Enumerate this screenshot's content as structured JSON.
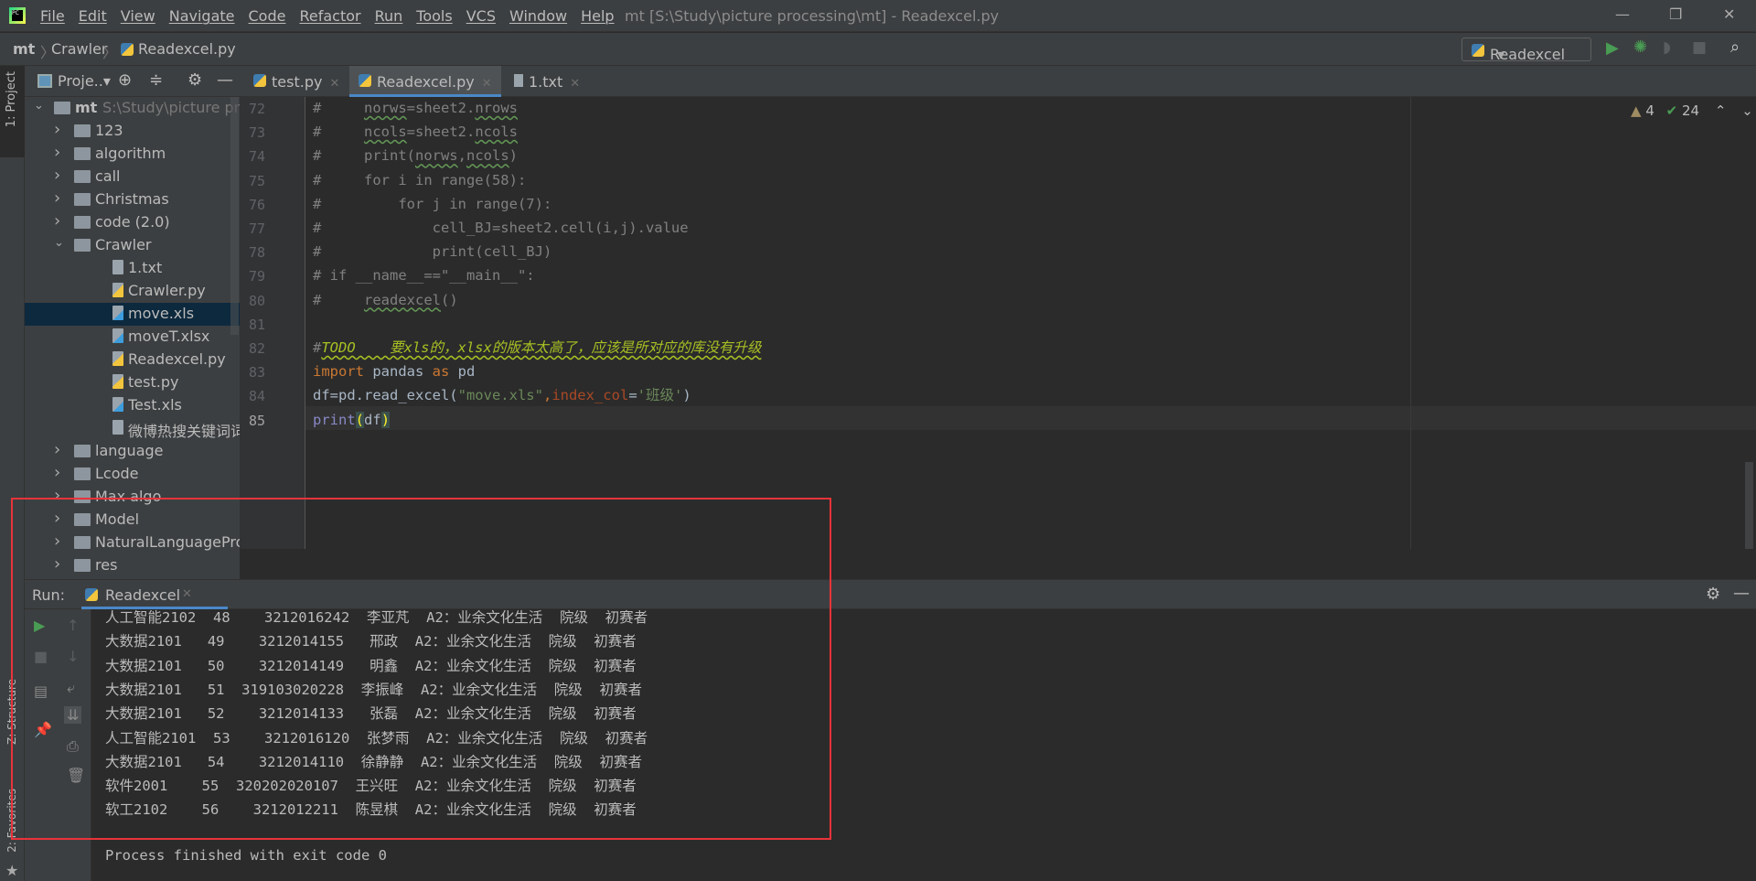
{
  "window": {
    "title": "mt [S:\\Study\\picture processing\\mt] - Readexcel.py",
    "logo": "PC"
  },
  "menu": [
    "File",
    "Edit",
    "View",
    "Navigate",
    "Code",
    "Refactor",
    "Run",
    "Tools",
    "VCS",
    "Window",
    "Help"
  ],
  "breadcrumb": [
    "mt",
    "Crawler",
    "Readexcel.py"
  ],
  "run_config": "Readexcel",
  "project_toolbar": {
    "label": "Proje..▾"
  },
  "left_strip": {
    "project": "1: Project",
    "structure": "Z: Structure",
    "favorites": "2: Favorites"
  },
  "tabs": [
    {
      "label": "test.py",
      "icon": "python-file-icon"
    },
    {
      "label": "Readexcel.py",
      "icon": "python-file-icon",
      "active": true
    },
    {
      "label": "1.txt",
      "icon": "text-file-icon"
    }
  ],
  "tree": [
    {
      "label": "mt",
      "extra": "S:\\Study\\picture proc",
      "type": "folder",
      "open": true,
      "depth": 0
    },
    {
      "label": "123",
      "type": "folder",
      "depth": 1
    },
    {
      "label": "algorithm",
      "type": "folder",
      "depth": 1
    },
    {
      "label": "call",
      "type": "folder",
      "depth": 1
    },
    {
      "label": "Christmas",
      "type": "folder",
      "depth": 1
    },
    {
      "label": "code   (2.0)",
      "type": "folder",
      "depth": 1
    },
    {
      "label": "Crawler",
      "type": "folder",
      "open": true,
      "depth": 1
    },
    {
      "label": "1.txt",
      "type": "file",
      "depth": 2
    },
    {
      "label": "Crawler.py",
      "type": "py",
      "depth": 2
    },
    {
      "label": "move.xls",
      "type": "unknown",
      "depth": 2,
      "selected": true
    },
    {
      "label": "moveT.xlsx",
      "type": "unknown",
      "depth": 2
    },
    {
      "label": "Readexcel.py",
      "type": "py",
      "depth": 2
    },
    {
      "label": "test.py",
      "type": "py",
      "depth": 2
    },
    {
      "label": "Test.xls",
      "type": "unknown",
      "depth": 2
    },
    {
      "label": "微博热搜关键词词频",
      "type": "file",
      "depth": 2
    },
    {
      "label": "language",
      "type": "folder",
      "depth": 1
    },
    {
      "label": "Lcode",
      "type": "folder",
      "depth": 1
    },
    {
      "label": "Max algo",
      "type": "folder",
      "depth": 1
    },
    {
      "label": "Model",
      "type": "folder",
      "depth": 1
    },
    {
      "label": "NaturalLanguageProc",
      "type": "folder",
      "depth": 1
    },
    {
      "label": "res",
      "type": "folder",
      "depth": 1
    }
  ],
  "inspections": {
    "warnings": "4",
    "typos": "24"
  },
  "code": [
    {
      "n": "72",
      "t": [
        [
          "#     ",
          "c"
        ],
        [
          "norws",
          "c u"
        ],
        [
          "=sheet2.",
          "c"
        ],
        [
          "nrows",
          "c u"
        ]
      ]
    },
    {
      "n": "73",
      "t": [
        [
          "#     ",
          "c"
        ],
        [
          "ncols",
          "c u"
        ],
        [
          "=sheet2.",
          "c"
        ],
        [
          "ncols",
          "c u"
        ]
      ]
    },
    {
      "n": "74",
      "t": [
        [
          "#     print(",
          "c"
        ],
        [
          "norws",
          "c u"
        ],
        [
          ",",
          "c"
        ],
        [
          "ncols",
          "c u"
        ],
        [
          ")",
          "c"
        ]
      ]
    },
    {
      "n": "75",
      "t": [
        [
          "#     for i in range(58):",
          "c"
        ]
      ]
    },
    {
      "n": "76",
      "t": [
        [
          "#         for j in range(7):",
          "c"
        ]
      ]
    },
    {
      "n": "77",
      "t": [
        [
          "#             cell_BJ=sheet2.cell(i,j).value",
          "c"
        ]
      ]
    },
    {
      "n": "78",
      "t": [
        [
          "#             print(cell_BJ)",
          "c"
        ]
      ]
    },
    {
      "n": "79",
      "t": [
        [
          "# if __name__==\"__main__\":",
          "c"
        ]
      ]
    },
    {
      "n": "80",
      "t": [
        [
          "#     ",
          "c"
        ],
        [
          "readexcel",
          "c u"
        ],
        [
          "()",
          "c"
        ]
      ]
    },
    {
      "n": "81",
      "t": []
    },
    {
      "n": "82",
      "t": [
        [
          "#",
          "c"
        ],
        [
          "TODO    要xls的，xlsx的版本太高了，应该是所对应的库没有升级",
          "todo"
        ]
      ]
    },
    {
      "n": "83",
      "t": [
        [
          "import",
          "k"
        ],
        [
          " pandas ",
          "n"
        ],
        [
          "as",
          "k"
        ],
        [
          " pd",
          "n"
        ]
      ]
    },
    {
      "n": "84",
      "t": [
        [
          "df=pd.read_excel(",
          "n"
        ],
        [
          "\"move.xls\"",
          "s"
        ],
        [
          ",",
          "k"
        ],
        [
          "index_col",
          "p"
        ],
        [
          "=",
          "n"
        ],
        [
          "'班级'",
          "s"
        ],
        [
          ")",
          "n"
        ]
      ]
    },
    {
      "n": "85",
      "t": [
        [
          "print",
          "b"
        ],
        [
          "(",
          "h"
        ],
        [
          "df",
          "n"
        ],
        [
          ")",
          "h"
        ]
      ]
    }
  ],
  "run": {
    "label": "Run:",
    "tab": "Readexcel"
  },
  "console": [
    "人工智能2102  48    3212016242  李亚芃  A2：业余文化生活  院级  初赛者",
    "大数据2101   49    3212014155   邢政  A2：业余文化生活  院级  初赛者",
    "大数据2101   50    3212014149   明鑫  A2：业余文化生活  院级  初赛者",
    "大数据2101   51  319103020228  李振峰  A2：业余文化生活  院级  初赛者",
    "大数据2101   52    3212014133   张磊  A2：业余文化生活  院级  初赛者",
    "人工智能2101  53    3212016120  张梦雨  A2：业余文化生活  院级  初赛者",
    "大数据2101   54    3212014110  徐静静  A2：业余文化生活  院级  初赛者",
    "软件2001    55  320202020107  王兴旺  A2：业余文化生活  院级  初赛者",
    "软工2102    56    3212012211  陈昱棋  A2：业余文化生活  院级  初赛者",
    "",
    "Process finished with exit code 0"
  ],
  "colors": {
    "annotation_box": "#e8333a",
    "run_green": "#499c54",
    "selection": "#0d293e"
  }
}
